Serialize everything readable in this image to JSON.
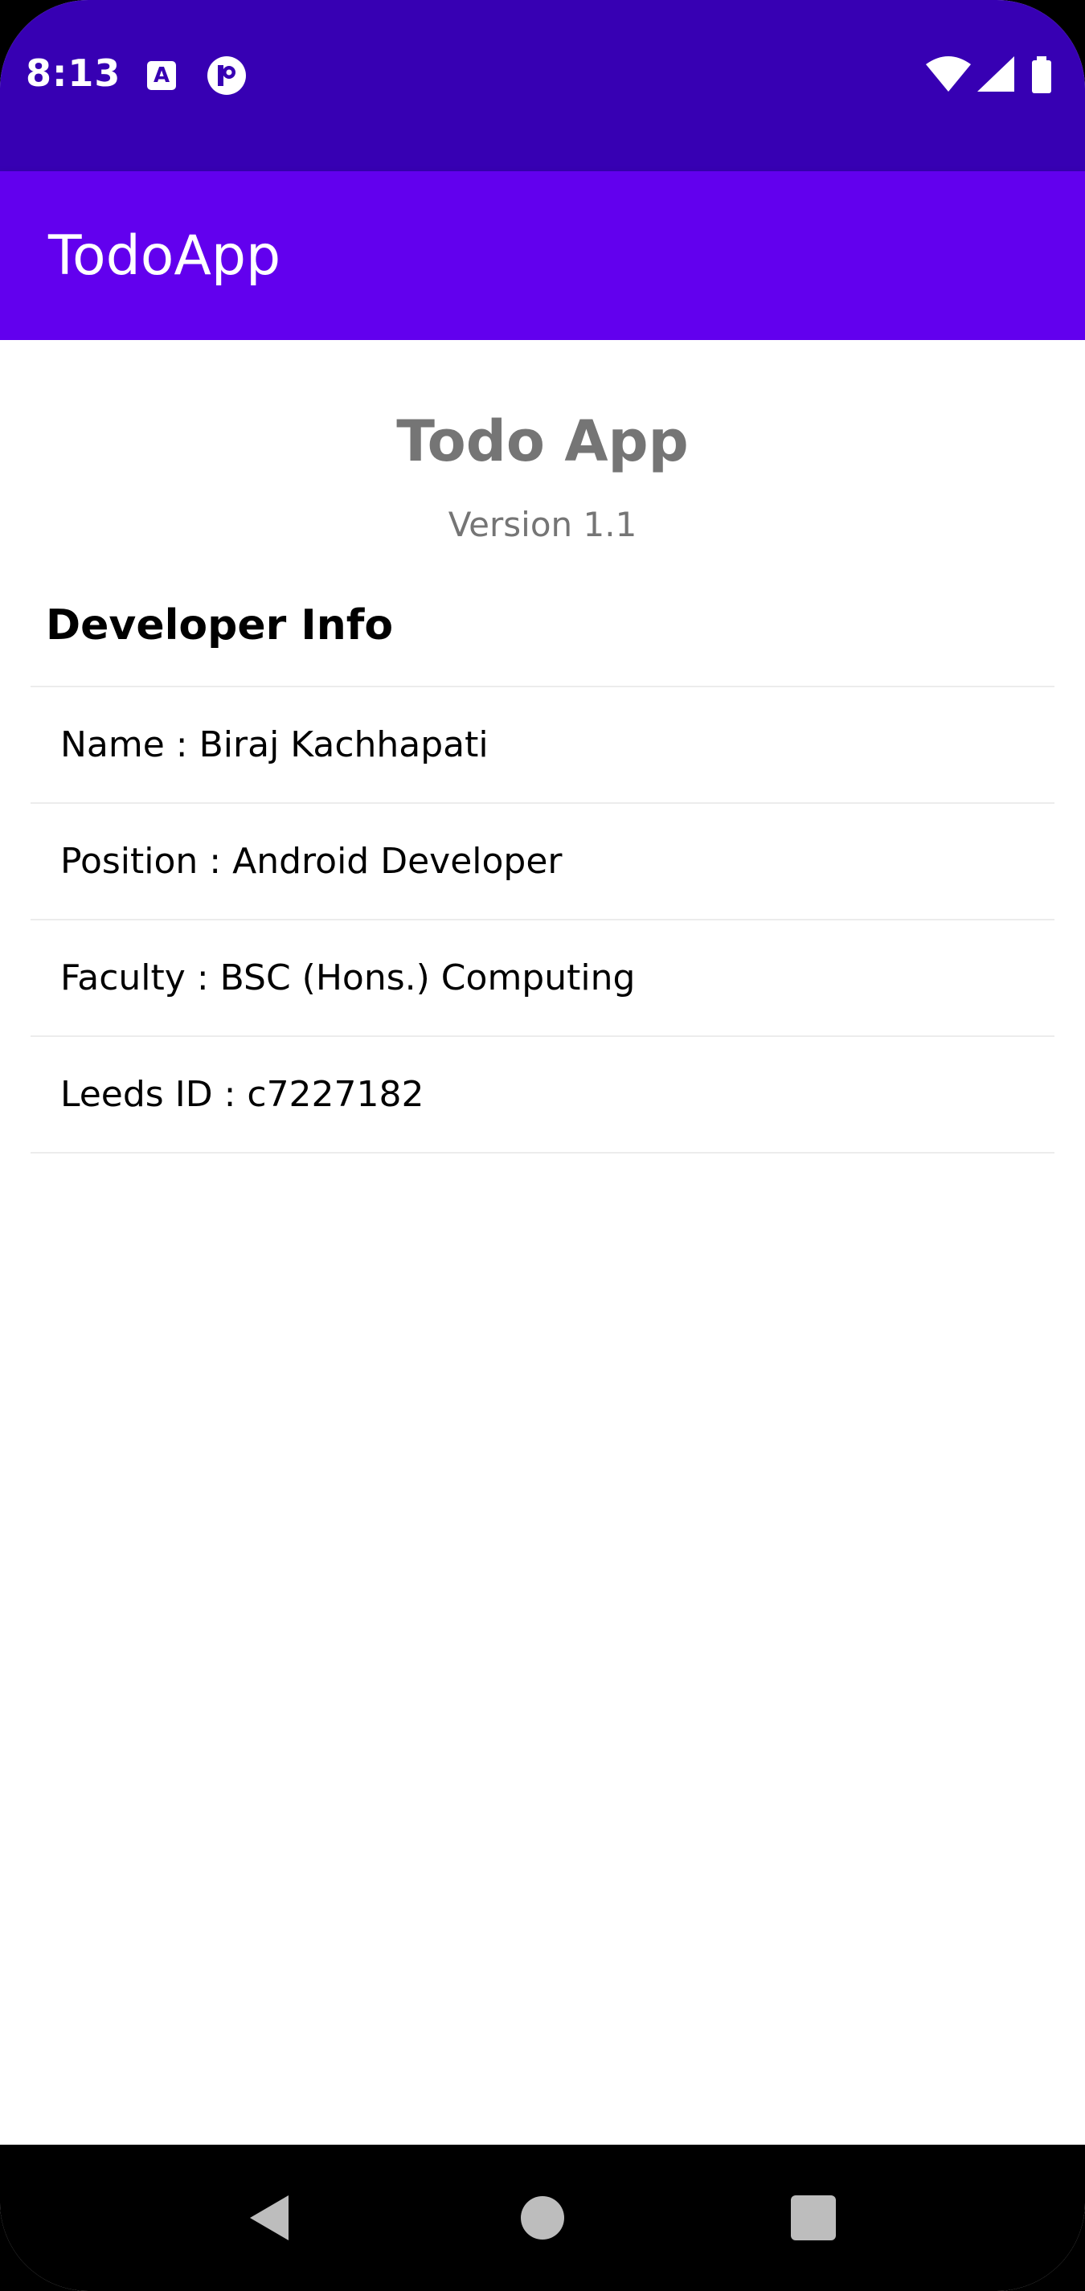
{
  "status_bar": {
    "time": "8:13",
    "icons": [
      "a-notification-icon",
      "p-notification-icon",
      "wifi-icon",
      "signal-icon",
      "battery-icon"
    ]
  },
  "app_bar": {
    "title": "TodoApp"
  },
  "main": {
    "app_name": "Todo App",
    "version": "Version 1.1",
    "section_title": "Developer Info",
    "info_items": [
      "Name : Biraj Kachhapati",
      "Position : Android Developer",
      "Faculty : BSC (Hons.) Computing",
      "Leeds ID : c7227182"
    ]
  },
  "colors": {
    "status_bar": "#3700B3",
    "app_bar": "#6200EE",
    "secondary_text": "#757575"
  },
  "nav_bar": {
    "buttons": [
      "back-icon",
      "home-icon",
      "recents-icon"
    ]
  }
}
